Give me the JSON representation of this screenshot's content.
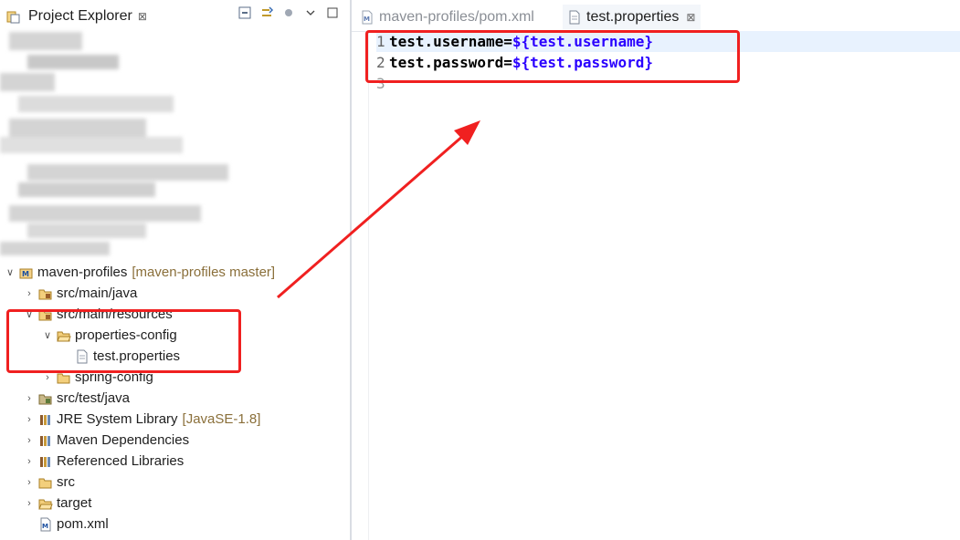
{
  "explorer": {
    "title": "Project Explorer",
    "close_glyph": "⊠",
    "toolbar_icons": [
      "collapse-all-icon",
      "link-with-editor-icon",
      "filter-icon",
      "view-menu-icon",
      "minimize-icon"
    ]
  },
  "tree": {
    "project": {
      "name": "maven-profiles",
      "decoration": "[maven-profiles master]"
    },
    "items": [
      {
        "label": "src/main/java",
        "icon": "source-folder-icon"
      },
      {
        "label": "src/main/resources",
        "icon": "source-folder-icon"
      },
      {
        "label": "properties-config",
        "icon": "open-folder-icon"
      },
      {
        "label": "test.properties",
        "icon": "properties-file-icon"
      },
      {
        "label": "spring-config",
        "icon": "folder-icon"
      },
      {
        "label": "src/test/java",
        "icon": "test-source-folder-icon"
      },
      {
        "label": "JRE System Library",
        "decoration": "[JavaSE-1.8]",
        "icon": "library-icon"
      },
      {
        "label": "Maven Dependencies",
        "icon": "library-icon"
      },
      {
        "label": "Referenced Libraries",
        "icon": "library-icon"
      },
      {
        "label": "src",
        "icon": "folder-icon"
      },
      {
        "label": "target",
        "icon": "open-folder-icon"
      },
      {
        "label": "pom.xml",
        "icon": "maven-xml-icon"
      }
    ]
  },
  "editor": {
    "tabs": [
      {
        "label": "maven-profiles/pom.xml",
        "active": false
      },
      {
        "label": "test.properties",
        "active": true
      }
    ],
    "lines": [
      {
        "num": "1",
        "key": "test.username=",
        "value": "${test.username}"
      },
      {
        "num": "2",
        "key": "test.password=",
        "value": "${test.password}"
      },
      {
        "num": "3",
        "key": "",
        "value": ""
      }
    ]
  },
  "colors": {
    "annotation_red": "#f02020",
    "property_value": "#2a00ff",
    "decoration": "#8a6f3a"
  }
}
